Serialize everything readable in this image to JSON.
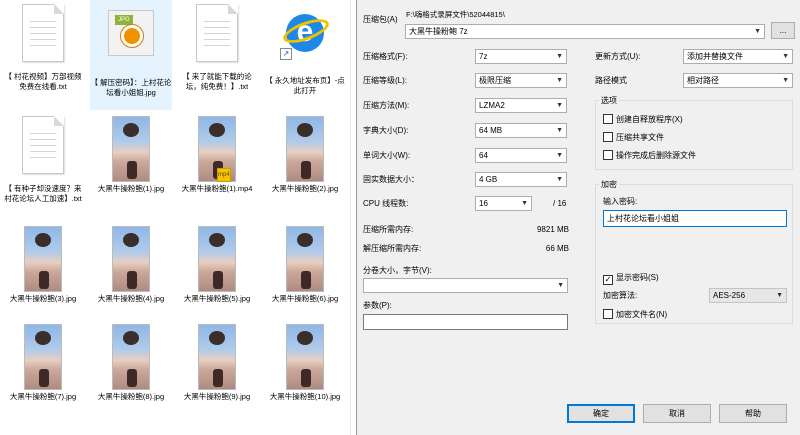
{
  "explorer": {
    "files": [
      {
        "name": "【 村花视频】万部视频免费在线看.txt",
        "icon": "text-file-icon"
      },
      {
        "name": "【 解压密码】：上村花论坛看小姐姐.jpg",
        "icon": "jpg-file-icon"
      },
      {
        "name": "【 来了就能下载的论坛，纯免费！】.txt",
        "icon": "text-file-icon"
      },
      {
        "name": "【 永久地址发布页】-点此打开",
        "icon": "internet-explorer-icon"
      },
      {
        "name": "【 有种子却没速度？来村花论坛人工加速】.txt",
        "icon": "text-file-icon"
      },
      {
        "name": "大黑牛操粉鲍(1).jpg",
        "icon": "image-thumbnail"
      },
      {
        "name": "大黑牛操粉鲍(1).mp4",
        "icon": "video-thumbnail"
      },
      {
        "name": "大黑牛操粉鲍(2).jpg",
        "icon": "image-thumbnail"
      },
      {
        "name": "大黑牛操粉鲍(3).jpg",
        "icon": "image-thumbnail"
      },
      {
        "name": "大黑牛操粉鲍(4).jpg",
        "icon": "image-thumbnail"
      },
      {
        "name": "大黑牛操粉鲍(5).jpg",
        "icon": "image-thumbnail"
      },
      {
        "name": "大黑牛操粉鲍(6).jpg",
        "icon": "image-thumbnail"
      },
      {
        "name": "大黑牛操粉鲍(7).jpg",
        "icon": "image-thumbnail"
      },
      {
        "name": "大黑牛操粉鲍(8).jpg",
        "icon": "image-thumbnail"
      },
      {
        "name": "大黑牛操粉鲍(9).jpg",
        "icon": "image-thumbnail"
      },
      {
        "name": "大黑牛操粉鲍(10).jpg",
        "icon": "image-thumbnail"
      }
    ],
    "mp4_badge": "mp4"
  },
  "dialog": {
    "archive_label": "压缩包(A)",
    "archive_path": "F:\\嗨格式录屏文件\\52044815\\",
    "archive_name": "大黑牛操粉鲍 7z",
    "browse_label": "...",
    "format_label": "压缩格式(F):",
    "format_value": "7z",
    "level_label": "压缩等级(L):",
    "level_value": "极限压缩",
    "method_label": "压缩方法(M):",
    "method_value": "LZMA2",
    "dict_label": "字典大小(D):",
    "dict_value": "64 MB",
    "word_label": "单词大小(W):",
    "word_value": "64",
    "solid_label": "固实数据大小：",
    "solid_value": "4 GB",
    "cpu_label": "CPU 线程数:",
    "cpu_value": "16",
    "cpu_total": "/ 16",
    "mem_compress_label": "压缩所需内存:",
    "mem_compress_value": "9821 MB",
    "mem_decompress_label": "解压缩所需内存:",
    "mem_decompress_value": "66 MB",
    "split_label": "分卷大小，字节(V):",
    "split_value": "",
    "params_label": "参数(P):",
    "params_value": "",
    "update_label": "更新方式(U):",
    "update_value": "添加并替换文件",
    "path_mode_label": "路径模式",
    "path_mode_value": "相对路径",
    "options_title": "选项",
    "opt_sfx": "创建自释放程序(X)",
    "opt_shared": "压缩共享文件",
    "opt_delete": "操作完成后删除源文件",
    "encrypt_title": "加密",
    "password_label": "输入密码:",
    "password_value": "上村花论坛看小姐姐",
    "show_password": "显示密码(S)",
    "show_password_check": "✓",
    "enc_method_label": "加密算法:",
    "enc_method_value": "AES-256",
    "encrypt_names": "加密文件名(N)",
    "ok": "确定",
    "cancel": "取消",
    "help": "帮助"
  },
  "colors": {
    "dialog_bg": "#f0f0f0",
    "accent": "#0078d7",
    "selection": "#cce8ff"
  }
}
